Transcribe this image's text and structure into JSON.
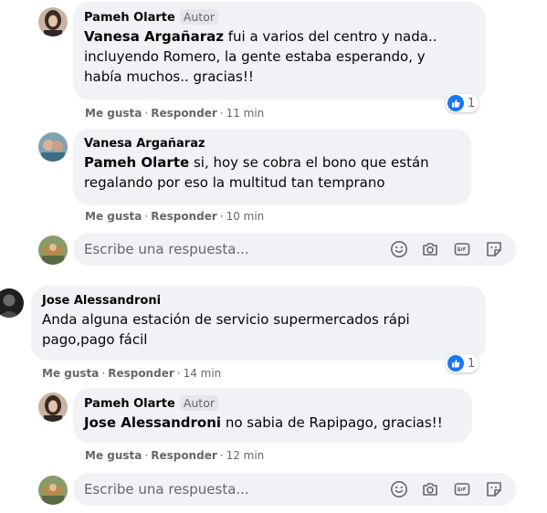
{
  "colors": {
    "bubble": "#f0f2f5",
    "meta": "#65676b",
    "like_blue": "#1877f2",
    "text": "#050505"
  },
  "comments": [
    {
      "author": "Pameh Olarte",
      "badge": "Autor",
      "mention": "Vanesa Argañaraz",
      "text": " fui a varios del centro y nada..\nincluyendo Romero, la gente estaba esperando, y\nhabía muchos.. gracias!!",
      "actions": {
        "like": "Me gusta",
        "reply": "Responder",
        "time": "11 min"
      },
      "reactions": {
        "icon": "like-icon",
        "count": "1"
      }
    },
    {
      "author": "Vanesa Argañaraz",
      "mention": "Pameh Olarte",
      "text": " si, hoy se cobra el bono que están\nregalando por eso la multitud tan temprano",
      "actions": {
        "like": "Me gusta",
        "reply": "Responder",
        "time": "10 min"
      }
    },
    {
      "author": "Jose Alessandroni",
      "text": "Anda alguna estación de servicio supermercados rápi\npago,pago fácil",
      "actions": {
        "like": "Me gusta",
        "reply": "Responder",
        "time": "14 min"
      },
      "reactions": {
        "icon": "like-icon",
        "count": "1"
      }
    },
    {
      "author": "Pameh Olarte",
      "badge": "Autor",
      "mention": "Jose Alessandroni",
      "text": " no sabia de Rapipago, gracias!!",
      "actions": {
        "like": "Me gusta",
        "reply": "Responder",
        "time": "12 min"
      }
    }
  ],
  "composers": [
    {
      "placeholder": "Escribe una respuesta...",
      "tools": [
        "emoji-icon",
        "camera-icon",
        "gif-icon",
        "sticker-icon"
      ]
    },
    {
      "placeholder": "Escribe una respuesta...",
      "tools": [
        "emoji-icon",
        "camera-icon",
        "gif-icon",
        "sticker-icon"
      ]
    }
  ]
}
